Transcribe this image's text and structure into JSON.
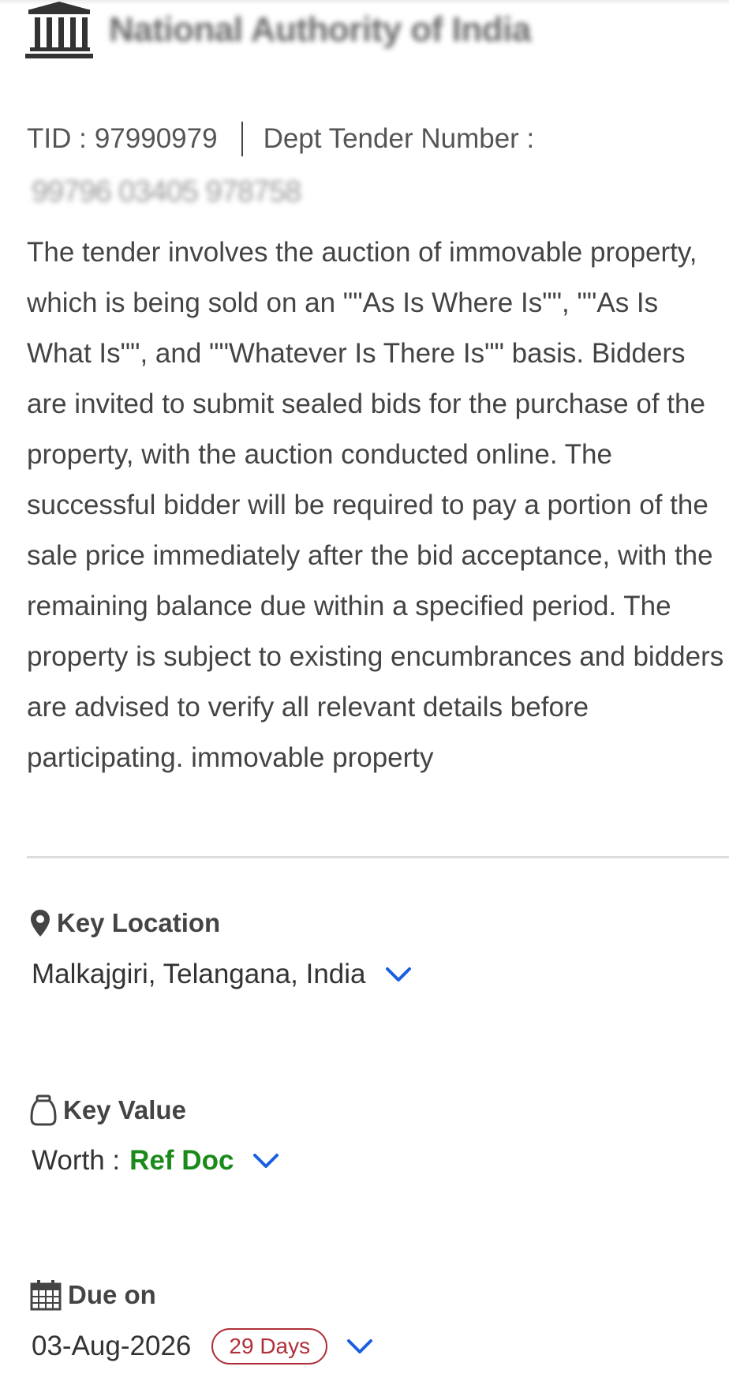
{
  "header": {
    "org_name": "National Authority of India",
    "org_icon": "bank-building-icon"
  },
  "tender": {
    "tid_label": "TID :",
    "tid_value": "97990979",
    "dept_label": "Dept Tender Number :",
    "dept_number": "99796 03405 978758",
    "description": "The tender involves the auction of immovable property, which is being sold on an \"\"As Is Where Is\"\", \"\"As Is What Is\"\", and \"\"Whatever Is There Is\"\" basis. Bidders are invited to submit sealed bids for the purchase of the property, with the auction conducted online. The successful bidder will be required to pay a portion of the sale price immediately after the bid acceptance, with the remaining balance due within a specified period. The property is subject to existing encumbrances and bidders are advised to verify all relevant details before participating. immovable property"
  },
  "location": {
    "label": "Key Location",
    "value": "Malkajgiri, Telangana, India",
    "icon": "map-pin-icon"
  },
  "value": {
    "label": "Key Value",
    "worth_label": "Worth :",
    "worth_value": "Ref Doc",
    "icon": "money-bag-icon"
  },
  "due": {
    "label": "Due on",
    "date": "03-Aug-2026",
    "days_left": "29 Days",
    "icon": "calendar-icon"
  },
  "colors": {
    "link_blue": "#1a5fe0",
    "ref_doc_green": "#1a8a1a",
    "badge_red": "#b0303a",
    "divider": "#dddddd"
  }
}
